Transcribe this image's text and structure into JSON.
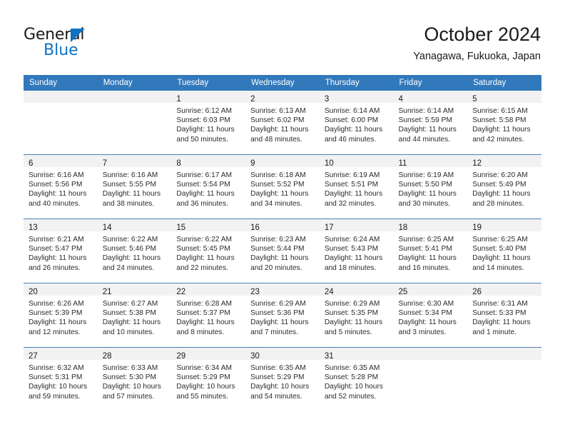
{
  "brand": {
    "name_top": "General",
    "name_bottom": "Blue",
    "accent_color": "#0e72c4"
  },
  "header": {
    "title": "October 2024",
    "subtitle": "Yanagawa, Fukuoka, Japan"
  },
  "theme": {
    "header_bg": "#3279bb",
    "daynum_band_bg": "#f2f2f2",
    "row_divider": "#4e80b5",
    "page_bg": "#ffffff"
  },
  "calendar": {
    "weekday_headers": [
      "Sunday",
      "Monday",
      "Tuesday",
      "Wednesday",
      "Thursday",
      "Friday",
      "Saturday"
    ],
    "weeks": [
      [
        {
          "day": "",
          "lines": []
        },
        {
          "day": "",
          "lines": []
        },
        {
          "day": "1",
          "lines": [
            "Sunrise: 6:12 AM",
            "Sunset: 6:03 PM",
            "Daylight: 11 hours",
            "and 50 minutes."
          ]
        },
        {
          "day": "2",
          "lines": [
            "Sunrise: 6:13 AM",
            "Sunset: 6:02 PM",
            "Daylight: 11 hours",
            "and 48 minutes."
          ]
        },
        {
          "day": "3",
          "lines": [
            "Sunrise: 6:14 AM",
            "Sunset: 6:00 PM",
            "Daylight: 11 hours",
            "and 46 minutes."
          ]
        },
        {
          "day": "4",
          "lines": [
            "Sunrise: 6:14 AM",
            "Sunset: 5:59 PM",
            "Daylight: 11 hours",
            "and 44 minutes."
          ]
        },
        {
          "day": "5",
          "lines": [
            "Sunrise: 6:15 AM",
            "Sunset: 5:58 PM",
            "Daylight: 11 hours",
            "and 42 minutes."
          ]
        }
      ],
      [
        {
          "day": "6",
          "lines": [
            "Sunrise: 6:16 AM",
            "Sunset: 5:56 PM",
            "Daylight: 11 hours",
            "and 40 minutes."
          ]
        },
        {
          "day": "7",
          "lines": [
            "Sunrise: 6:16 AM",
            "Sunset: 5:55 PM",
            "Daylight: 11 hours",
            "and 38 minutes."
          ]
        },
        {
          "day": "8",
          "lines": [
            "Sunrise: 6:17 AM",
            "Sunset: 5:54 PM",
            "Daylight: 11 hours",
            "and 36 minutes."
          ]
        },
        {
          "day": "9",
          "lines": [
            "Sunrise: 6:18 AM",
            "Sunset: 5:52 PM",
            "Daylight: 11 hours",
            "and 34 minutes."
          ]
        },
        {
          "day": "10",
          "lines": [
            "Sunrise: 6:19 AM",
            "Sunset: 5:51 PM",
            "Daylight: 11 hours",
            "and 32 minutes."
          ]
        },
        {
          "day": "11",
          "lines": [
            "Sunrise: 6:19 AM",
            "Sunset: 5:50 PM",
            "Daylight: 11 hours",
            "and 30 minutes."
          ]
        },
        {
          "day": "12",
          "lines": [
            "Sunrise: 6:20 AM",
            "Sunset: 5:49 PM",
            "Daylight: 11 hours",
            "and 28 minutes."
          ]
        }
      ],
      [
        {
          "day": "13",
          "lines": [
            "Sunrise: 6:21 AM",
            "Sunset: 5:47 PM",
            "Daylight: 11 hours",
            "and 26 minutes."
          ]
        },
        {
          "day": "14",
          "lines": [
            "Sunrise: 6:22 AM",
            "Sunset: 5:46 PM",
            "Daylight: 11 hours",
            "and 24 minutes."
          ]
        },
        {
          "day": "15",
          "lines": [
            "Sunrise: 6:22 AM",
            "Sunset: 5:45 PM",
            "Daylight: 11 hours",
            "and 22 minutes."
          ]
        },
        {
          "day": "16",
          "lines": [
            "Sunrise: 6:23 AM",
            "Sunset: 5:44 PM",
            "Daylight: 11 hours",
            "and 20 minutes."
          ]
        },
        {
          "day": "17",
          "lines": [
            "Sunrise: 6:24 AM",
            "Sunset: 5:43 PM",
            "Daylight: 11 hours",
            "and 18 minutes."
          ]
        },
        {
          "day": "18",
          "lines": [
            "Sunrise: 6:25 AM",
            "Sunset: 5:41 PM",
            "Daylight: 11 hours",
            "and 16 minutes."
          ]
        },
        {
          "day": "19",
          "lines": [
            "Sunrise: 6:25 AM",
            "Sunset: 5:40 PM",
            "Daylight: 11 hours",
            "and 14 minutes."
          ]
        }
      ],
      [
        {
          "day": "20",
          "lines": [
            "Sunrise: 6:26 AM",
            "Sunset: 5:39 PM",
            "Daylight: 11 hours",
            "and 12 minutes."
          ]
        },
        {
          "day": "21",
          "lines": [
            "Sunrise: 6:27 AM",
            "Sunset: 5:38 PM",
            "Daylight: 11 hours",
            "and 10 minutes."
          ]
        },
        {
          "day": "22",
          "lines": [
            "Sunrise: 6:28 AM",
            "Sunset: 5:37 PM",
            "Daylight: 11 hours",
            "and 8 minutes."
          ]
        },
        {
          "day": "23",
          "lines": [
            "Sunrise: 6:29 AM",
            "Sunset: 5:36 PM",
            "Daylight: 11 hours",
            "and 7 minutes."
          ]
        },
        {
          "day": "24",
          "lines": [
            "Sunrise: 6:29 AM",
            "Sunset: 5:35 PM",
            "Daylight: 11 hours",
            "and 5 minutes."
          ]
        },
        {
          "day": "25",
          "lines": [
            "Sunrise: 6:30 AM",
            "Sunset: 5:34 PM",
            "Daylight: 11 hours",
            "and 3 minutes."
          ]
        },
        {
          "day": "26",
          "lines": [
            "Sunrise: 6:31 AM",
            "Sunset: 5:33 PM",
            "Daylight: 11 hours",
            "and 1 minute."
          ]
        }
      ],
      [
        {
          "day": "27",
          "lines": [
            "Sunrise: 6:32 AM",
            "Sunset: 5:31 PM",
            "Daylight: 10 hours",
            "and 59 minutes."
          ]
        },
        {
          "day": "28",
          "lines": [
            "Sunrise: 6:33 AM",
            "Sunset: 5:30 PM",
            "Daylight: 10 hours",
            "and 57 minutes."
          ]
        },
        {
          "day": "29",
          "lines": [
            "Sunrise: 6:34 AM",
            "Sunset: 5:29 PM",
            "Daylight: 10 hours",
            "and 55 minutes."
          ]
        },
        {
          "day": "30",
          "lines": [
            "Sunrise: 6:35 AM",
            "Sunset: 5:29 PM",
            "Daylight: 10 hours",
            "and 54 minutes."
          ]
        },
        {
          "day": "31",
          "lines": [
            "Sunrise: 6:35 AM",
            "Sunset: 5:28 PM",
            "Daylight: 10 hours",
            "and 52 minutes."
          ]
        },
        {
          "day": "",
          "lines": []
        },
        {
          "day": "",
          "lines": []
        }
      ]
    ]
  }
}
